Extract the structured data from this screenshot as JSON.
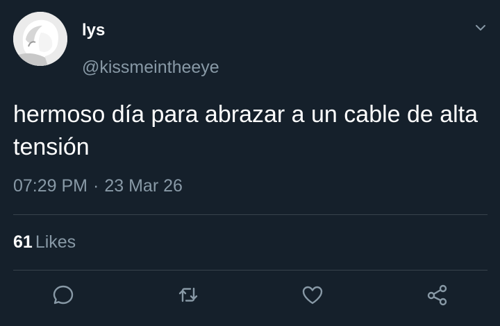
{
  "tweet": {
    "author": {
      "display_name": "lys",
      "handle": "@kissmeintheeye",
      "avatar": "avatar-photo"
    },
    "text": "hermoso día para abrazar a un cable de alta tensión",
    "time": "07:29 PM",
    "separator": "·",
    "date": "23 Mar 26",
    "likes": {
      "count": "61",
      "label": "Likes"
    },
    "menu_icon": "chevron-down-icon",
    "actions": [
      {
        "icon": "reply-icon"
      },
      {
        "icon": "retweet-icon"
      },
      {
        "icon": "like-icon"
      },
      {
        "icon": "share-icon"
      }
    ]
  },
  "colors": {
    "background": "#15202b",
    "text_primary": "#ffffff",
    "text_secondary": "#8899a6",
    "divider": "#38444d"
  }
}
